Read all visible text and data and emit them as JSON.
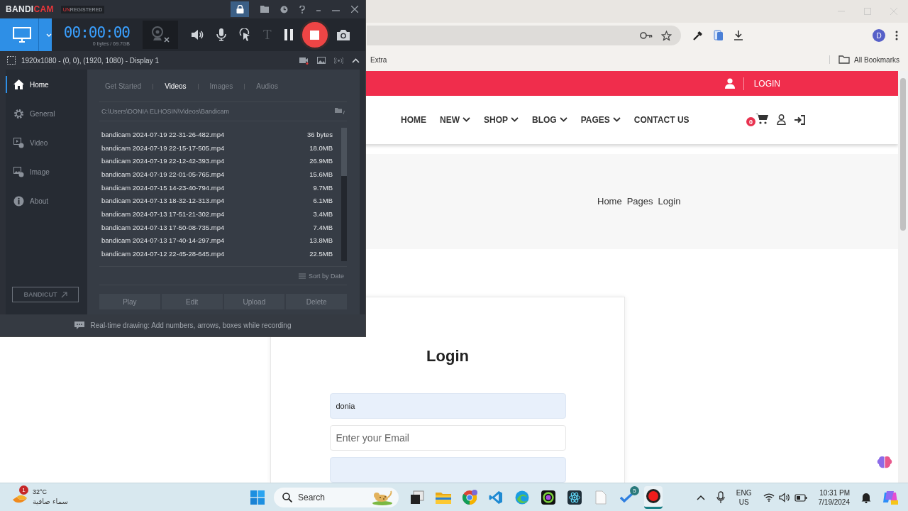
{
  "recorder": {
    "logo_main": "BANDI",
    "logo_accent": "CAM",
    "registration_accent": "UN",
    "registration": "REGISTERED",
    "timer": "00:00:00",
    "storage": "0 bytes / 69.7GB",
    "text_tool": {
      "glyph": "T",
      "disabled": true
    },
    "capture_area": "1920x1080 - (0, 0), (1920, 1080) - Display 1",
    "nav": [
      {
        "kind": "home",
        "label": "Home",
        "selected": true
      },
      {
        "kind": "general",
        "label": "General",
        "selected": false
      },
      {
        "kind": "video",
        "label": "Video",
        "selected": false
      },
      {
        "kind": "image",
        "label": "Image",
        "selected": false
      },
      {
        "kind": "about",
        "label": "About",
        "selected": false
      }
    ],
    "tabs": [
      {
        "label": "Get Started",
        "selected": false
      },
      {
        "label": "Videos",
        "selected": true
      },
      {
        "label": "Images",
        "selected": false
      },
      {
        "label": "Audios",
        "selected": false
      }
    ],
    "path": "C:\\Users\\DONIA ELHOSIN\\Videos\\Bandicam",
    "files": [
      {
        "name": "bandicam 2024-07-19 22-31-26-482.mp4",
        "size": "36 bytes"
      },
      {
        "name": "bandicam 2024-07-19 22-15-17-505.mp4",
        "size": "18.0MB"
      },
      {
        "name": "bandicam 2024-07-19 22-12-42-393.mp4",
        "size": "26.9MB"
      },
      {
        "name": "bandicam 2024-07-19 22-01-05-765.mp4",
        "size": "15.6MB"
      },
      {
        "name": "bandicam 2024-07-15 14-23-40-794.mp4",
        "size": "9.7MB"
      },
      {
        "name": "bandicam 2024-07-13 18-32-12-313.mp4",
        "size": "6.1MB"
      },
      {
        "name": "bandicam 2024-07-13 17-51-21-302.mp4",
        "size": "3.4MB"
      },
      {
        "name": "bandicam 2024-07-13 17-50-08-735.mp4",
        "size": "7.4MB"
      },
      {
        "name": "bandicam 2024-07-13 17-40-14-297.mp4",
        "size": "13.8MB"
      },
      {
        "name": "bandicam 2024-07-12 22-45-28-645.mp4",
        "size": "22.5MB"
      }
    ],
    "sort": "Sort by Date",
    "actions": [
      "Play",
      "Edit",
      "Upload",
      "Delete"
    ],
    "bandicut": "BANDICUT",
    "tip": "Real-time drawing: Add numbers, arrows, boxes while recording"
  },
  "browser": {
    "bookmark": "Extra",
    "all_bookmarks": "All Bookmarks",
    "profile_initial": "D"
  },
  "site": {
    "top_login": "LOGIN",
    "nav": [
      {
        "label": "HOME",
        "dropdown": false
      },
      {
        "label": "NEW",
        "dropdown": true
      },
      {
        "label": "SHOP",
        "dropdown": true
      },
      {
        "label": "BLOG",
        "dropdown": true
      },
      {
        "label": "PAGES",
        "dropdown": true
      },
      {
        "label": "CONTACT US",
        "dropdown": false
      }
    ],
    "cart_count": "0",
    "breadcrumb": [
      "Home",
      "Pages",
      "Login"
    ],
    "login": {
      "title": "Login",
      "fields": [
        {
          "value": "donia",
          "autofilled": true
        },
        {
          "placeholder": "Enter your Email",
          "autofilled": false
        },
        {
          "autofilled": true
        }
      ]
    }
  },
  "taskbar": {
    "weather": {
      "badge": "1",
      "temperature": "32°C",
      "condition": "سماء صافية"
    },
    "search_placeholder": "Search",
    "apps": [
      {
        "kind": "task-view",
        "selected": false
      },
      {
        "kind": "explorer",
        "selected": false
      },
      {
        "kind": "chrome",
        "selected": false
      },
      {
        "kind": "vscode",
        "selected": false
      },
      {
        "kind": "edge",
        "selected": false
      },
      {
        "kind": "ring-app",
        "selected": false
      },
      {
        "kind": "react",
        "selected": false
      },
      {
        "kind": "file",
        "selected": false
      },
      {
        "kind": "todo",
        "badge": "5",
        "selected": false
      },
      {
        "kind": "recorder",
        "selected": true
      }
    ],
    "language": "ENG",
    "region": "US",
    "time": "10:31 PM",
    "date": "7/19/2024"
  }
}
